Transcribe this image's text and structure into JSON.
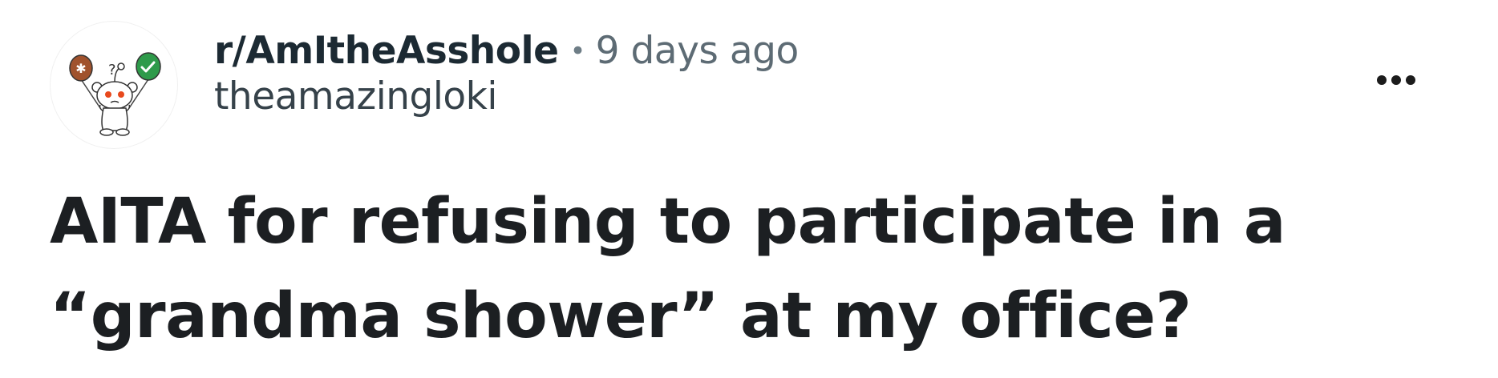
{
  "post": {
    "subreddit": "r/AmItheAsshole",
    "separator": "•",
    "age": "9 days ago",
    "author": "theamazingloki",
    "title": "AITA for refusing to participate in a “grandma shower” at my office?"
  },
  "icons": {
    "avatar": "reddit-snoo-avatar-icon",
    "more": "more-options-icon"
  },
  "colors": {
    "subreddit_text": "#1c2a33",
    "meta_text": "#5d6b74",
    "title_text": "#1c1f22",
    "balloon_left": "#a0522d",
    "balloon_right": "#2e9a4a",
    "snoo_eyes": "#e8491d"
  }
}
